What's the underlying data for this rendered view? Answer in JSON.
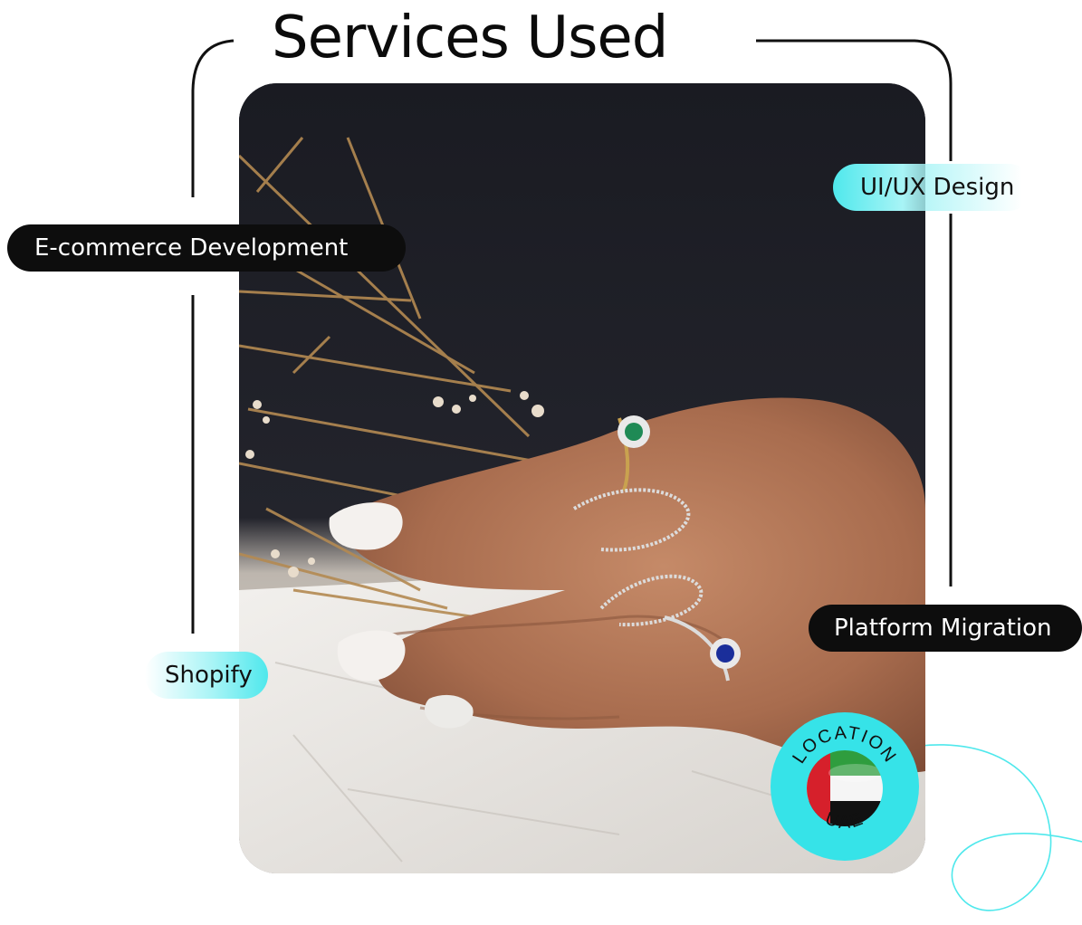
{
  "title": "Services Used",
  "services": {
    "ecommerce": "E-commerce Development",
    "uiux": "UI/UX Design",
    "platform_migration": "Platform Migration",
    "shopify": "Shopify"
  },
  "location": {
    "label": "LOCATION",
    "country": "UAE",
    "flag_icon": "uae-flag-icon"
  },
  "colors": {
    "accent_cyan": "#4fe8ec",
    "pill_dark": "#0d0d0d",
    "text_dark": "#0b0b0b"
  }
}
